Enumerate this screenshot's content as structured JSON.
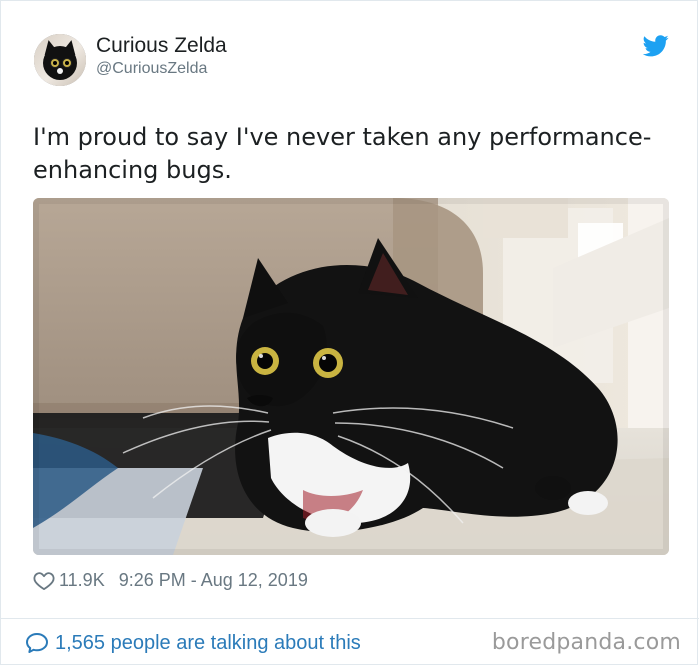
{
  "tweet": {
    "author_name": "Curious Zelda",
    "author_handle": "@CuriousZelda",
    "text": "I'm proud to say I've never taken any performance-\nenhancing bugs.",
    "likes": "11.9K",
    "timestamp": "9:26 PM - Aug 12, 2019",
    "talking_about": "1,565 people are talking about this"
  },
  "icons": {
    "brand": "twitter-bird-icon",
    "like": "heart-icon",
    "reply": "comment-bubble-icon"
  },
  "colors": {
    "brand_blue": "#1da1f2",
    "link_blue": "#2b7bb9",
    "meta_gray": "#697882",
    "text_dark": "#1c2022"
  },
  "watermark": {
    "text": "boredpanda.com"
  }
}
